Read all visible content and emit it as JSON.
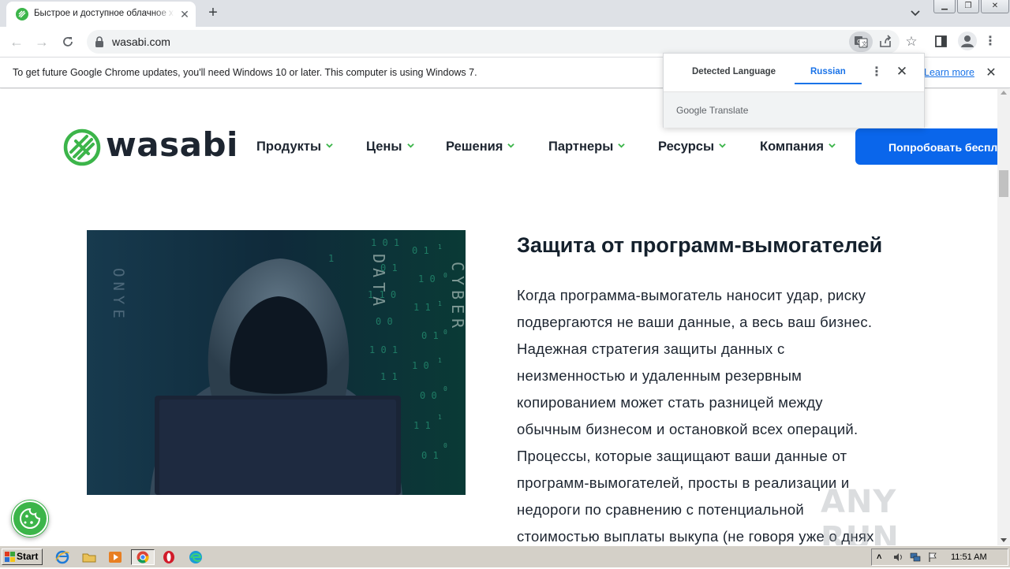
{
  "browser": {
    "tab_title": "Быстрое и доступное облачное хр",
    "url": "wasabi.com",
    "infobar_text": "To get future Google Chrome updates, you'll need Windows 10 or later. This computer is using Windows 7.",
    "infobar_link": "Learn more"
  },
  "translate_popup": {
    "tab_detected": "Detected Language",
    "tab_target": "Russian",
    "brand_google": "Google",
    "brand_translate": "Translate"
  },
  "site": {
    "logo_text": "wasabi",
    "nav": [
      {
        "label": "Продукты"
      },
      {
        "label": "Цены"
      },
      {
        "label": "Решения"
      },
      {
        "label": "Партнеры"
      },
      {
        "label": "Ресурсы"
      },
      {
        "label": "Компания"
      }
    ],
    "cta_label": "Попробовать беспл",
    "heading": "Защита от программ-вымогателей",
    "paragraph_lines": [
      "Когда программа-вымогатель наносит удар, риску",
      "подвергаются не ваши данные, а весь ваш бизнес.",
      "Надежная стратегия защиты данных с",
      "неизменностью и удаленным резервным",
      "копированием может стать разницей между",
      "обычным бизнесом и остановкой всех операций.",
      "Процессы, которые защищают ваши данные от",
      "программ-вымогателей, просты в реализации и",
      "недороги по сравнению с потенциальной",
      "стоимостью выплаты выкупа (не говоря уже о днях"
    ],
    "image_letters": {
      "left": "ONYE",
      "middle": "DATA",
      "right": "CYBER"
    }
  },
  "watermark": "ANY RUN",
  "taskbar": {
    "start_label": "Start",
    "clock": "11:51 AM"
  },
  "colors": {
    "brand_green": "#3cb54a",
    "cta_blue": "#0a66eb",
    "link_blue": "#1a73e8"
  }
}
